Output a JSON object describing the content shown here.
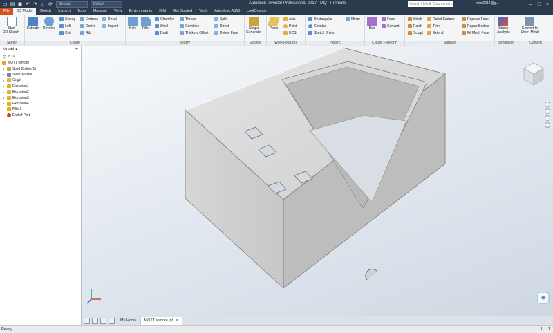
{
  "window": {
    "app_title": "Autodesk Inventor Professional 2017",
    "doc_title": "MQTT remote",
    "search_placeholder": "Search Help & Commands...",
    "user": "mimi2014@g...",
    "material": "Generic",
    "appearance": "Default"
  },
  "tabs": [
    "File",
    "3D Model",
    "Sketch",
    "Inspect",
    "Tools",
    "Manage",
    "View",
    "Environments",
    "BIM",
    "Get Started",
    "Vault",
    "Autodesk A360",
    "coolOrange"
  ],
  "ribbon": {
    "sketch": {
      "start": "Start",
      "start2": "2D Sketch",
      "label": "Sketch"
    },
    "create": {
      "extrude": "Extrude",
      "revolve": "Revolve",
      "sweep": "Sweep",
      "loft": "Loft",
      "coil": "Coil",
      "emboss": "Emboss",
      "derive": "Derive",
      "rib": "Rib",
      "decal": "Decal",
      "import": "Import",
      "label": "Create"
    },
    "modify": {
      "hole": "Hole",
      "fillet": "Fillet",
      "chamfer": "Chamfer",
      "shell": "Shell",
      "draft": "Draft",
      "thread": "Thread",
      "combine": "Combine",
      "thicken": "Thicken/ Offset",
      "split": "Split",
      "direct": "Direct",
      "delete_face": "Delete Face",
      "label": "Modify"
    },
    "explore": {
      "shape": "Shape",
      "shape2": "Generator",
      "label": "Explore"
    },
    "work": {
      "plane": "Plane",
      "axis": "Axis",
      "point": "Point",
      "ucs": "UCS",
      "label": "Work Features"
    },
    "pattern": {
      "rect": "Rectangular",
      "circ": "Circular",
      "sketch": "Sketch Driven",
      "mirror": "Mirror",
      "label": "Pattern"
    },
    "freeform": {
      "box": "Box",
      "face": "Face",
      "convert": "Convert",
      "label": "Create Freeform"
    },
    "surface": {
      "stitch": "Stitch",
      "patch": "Patch",
      "sculpt": "Sculpt",
      "ruled": "Ruled Surface",
      "trim": "Trim",
      "extend": "Extend",
      "replace": "Replace Face",
      "repair": "Repair Bodies",
      "fit_mesh": "Fit Mesh Face",
      "label": "Surface"
    },
    "simulation": {
      "stress": "Stress",
      "stress2": "Analysis",
      "label": "Simulation"
    },
    "convert": {
      "sheet": "Convert to",
      "sheet2": "Sheet Metal",
      "label": "Convert"
    }
  },
  "browser": {
    "title": "Model",
    "items": [
      {
        "label": "MQTT remote",
        "color": "#e0a51f"
      },
      {
        "label": "Solid Bodies(1)",
        "color": "#c9a15a"
      },
      {
        "label": "View: Master",
        "color": "#6f8aa8"
      },
      {
        "label": "Origin",
        "color": "#e0b43c"
      },
      {
        "label": "Extrusion1",
        "color": "#e3b21a"
      },
      {
        "label": "Extrusion2",
        "color": "#e3b21a"
      },
      {
        "label": "Extrusion3",
        "color": "#e3b21a"
      },
      {
        "label": "Extrusion4",
        "color": "#e3b21a"
      },
      {
        "label": "Fillet1",
        "color": "#e3b21a"
      },
      {
        "label": "End of Part",
        "color": "#d43a2a"
      }
    ]
  },
  "doc_tabs": {
    "home": "My Home",
    "doc": "MQTT remote.ipt"
  },
  "status": {
    "left": "Ready",
    "n1": "1",
    "n2": "1"
  },
  "viewcube_face": "TOP"
}
